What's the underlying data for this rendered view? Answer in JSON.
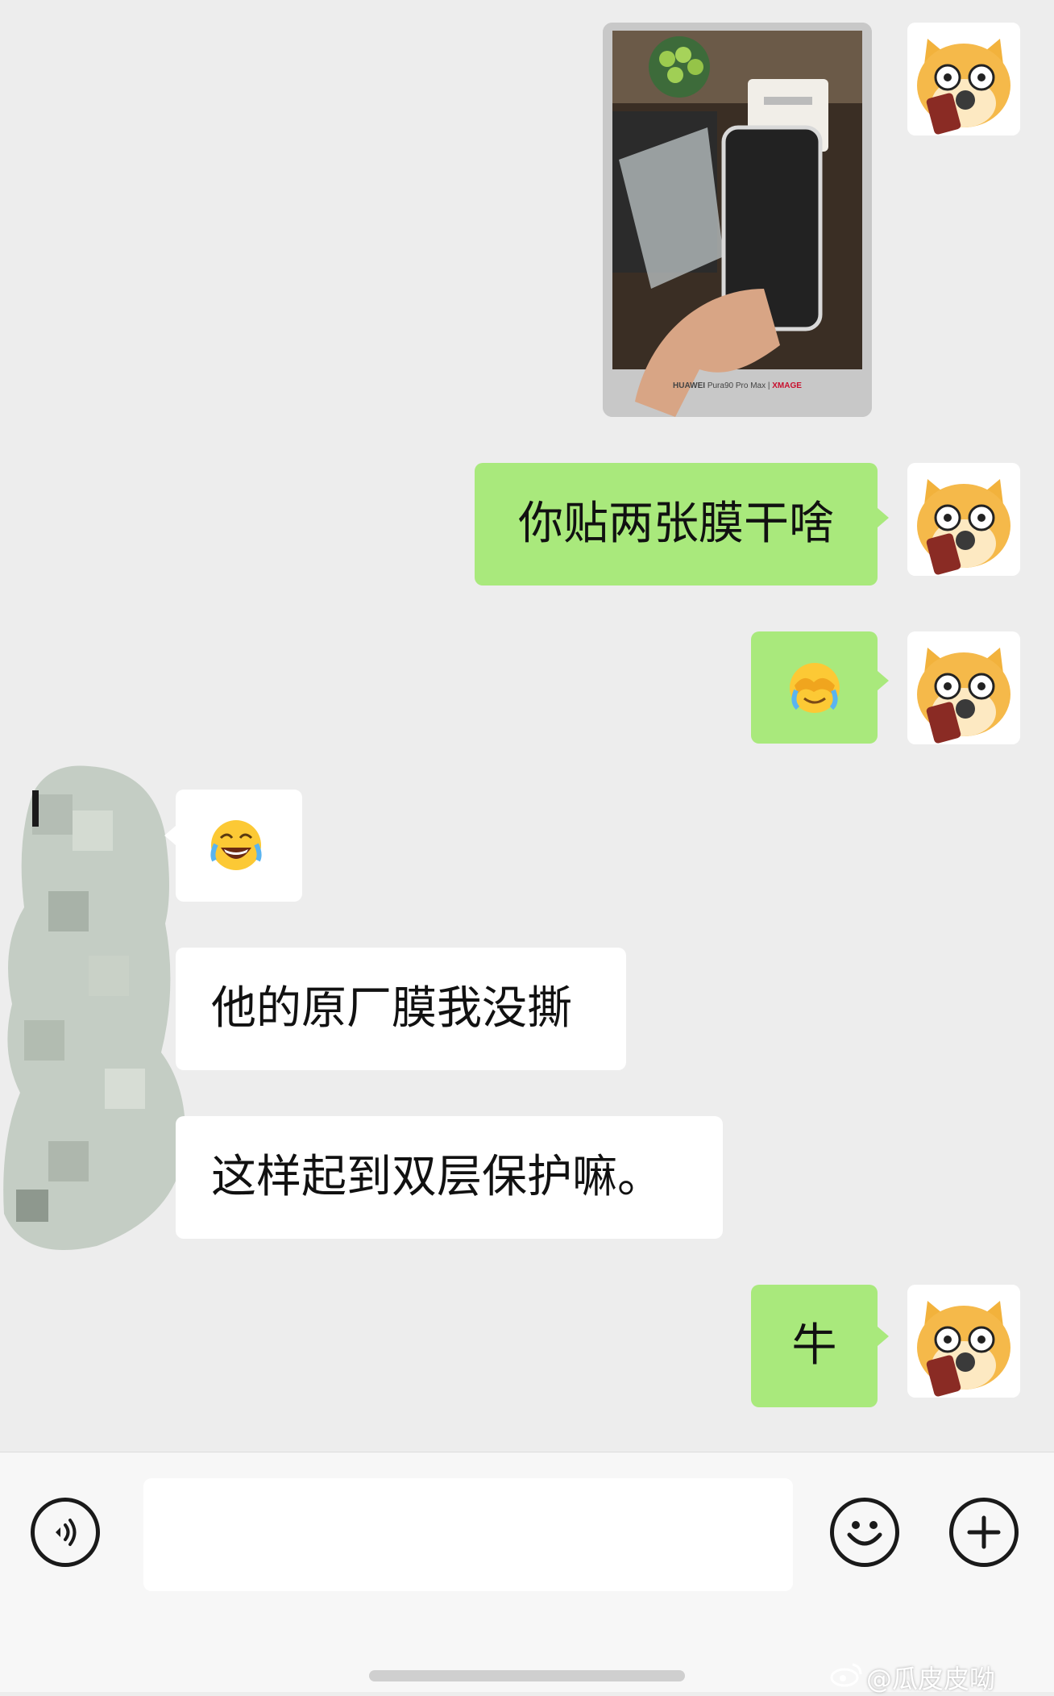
{
  "chat": {
    "messages": [
      {
        "id": "m1",
        "sender": "me",
        "type": "image",
        "image_caption_brand": "HUAWEI",
        "image_caption_model": "Pura90 Pro Max",
        "image_caption_sep": "|",
        "image_caption_xmage": "XMAGE"
      },
      {
        "id": "m2",
        "sender": "me",
        "type": "text",
        "text": "你贴两张膜干啥"
      },
      {
        "id": "m3",
        "sender": "me",
        "type": "emoji",
        "emoji_name": "crying-face-covering-eyes"
      },
      {
        "id": "m4",
        "sender": "them",
        "type": "emoji",
        "emoji_name": "face-with-tears-of-joy"
      },
      {
        "id": "m5",
        "sender": "them",
        "type": "text",
        "text": "他的原厂膜我没撕"
      },
      {
        "id": "m6",
        "sender": "them",
        "type": "text",
        "text": "这样起到双层保护嘛。"
      },
      {
        "id": "m7",
        "sender": "me",
        "type": "text",
        "text": "牛"
      }
    ]
  },
  "input_bar": {
    "voice_icon": "voice-icon",
    "emoji_icon": "emoji-icon",
    "plus_icon": "plus-icon",
    "input_value": ""
  },
  "watermark": {
    "text": "@瓜皮皮呦"
  },
  "colors": {
    "background": "#ededed",
    "my_bubble": "#a9e97c",
    "their_bubble": "#ffffff"
  }
}
